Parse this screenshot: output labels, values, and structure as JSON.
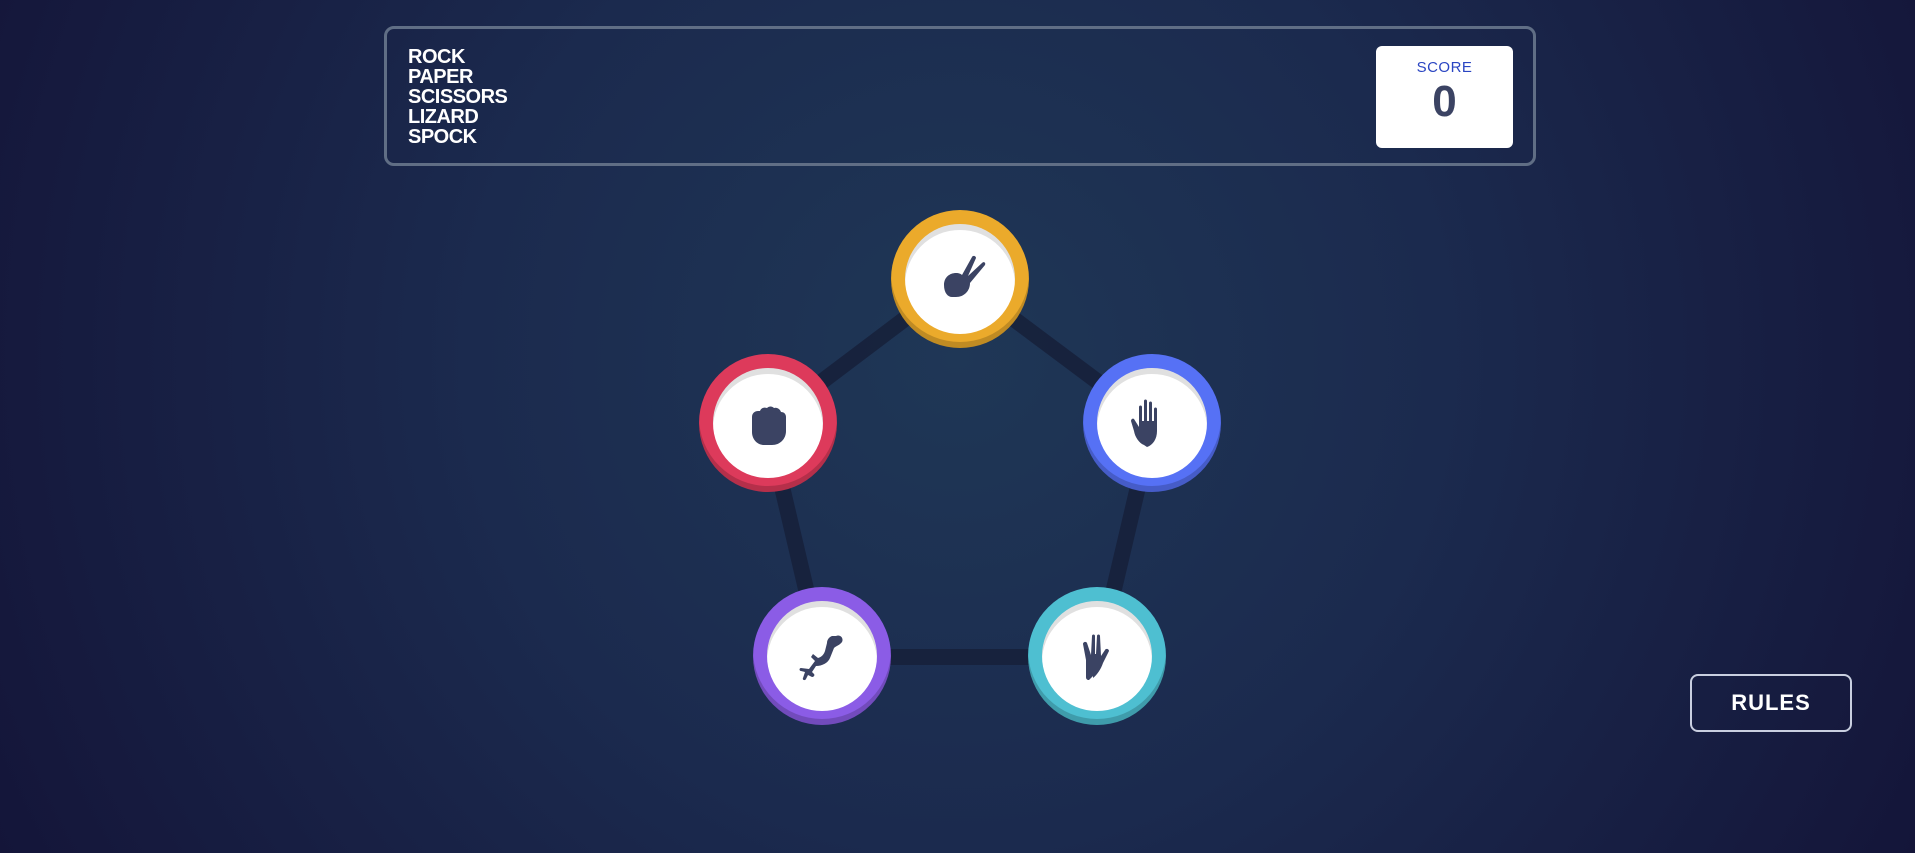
{
  "header": {
    "title_lines": [
      "ROCK",
      "PAPER",
      "SCISSORS",
      "LIZARD",
      "SPOCK"
    ],
    "score_label": "SCORE",
    "score_value": "0"
  },
  "choices": [
    {
      "id": "scissors",
      "color": "#ebaa2b",
      "icon": "scissors-hand-icon"
    },
    {
      "id": "paper",
      "color": "#5671f5",
      "icon": "paper-hand-icon"
    },
    {
      "id": "spock",
      "color": "#4ebfd1",
      "icon": "spock-hand-icon"
    },
    {
      "id": "lizard",
      "color": "#8b5ce6",
      "icon": "lizard-icon"
    },
    {
      "id": "rock",
      "color": "#dd3a5b",
      "icon": "rock-fist-icon"
    }
  ],
  "footer": {
    "rules_label": "RULES"
  }
}
